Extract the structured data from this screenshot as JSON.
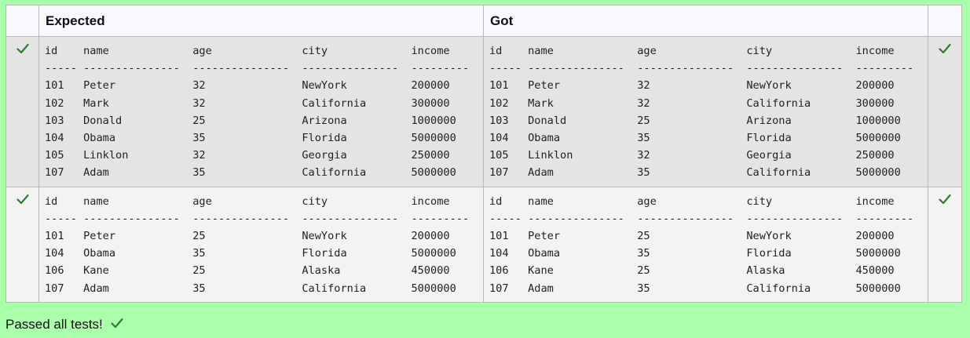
{
  "header": {
    "expected_label": "Expected",
    "got_label": "Got"
  },
  "tests": [
    {
      "expected": "id    name             age              city             income\n----- ---------------  ---------------  ---------------  ---------\n101   Peter            32               NewYork          200000\n102   Mark             32               California       300000\n103   Donald           25               Arizona          1000000\n104   Obama            35               Florida          5000000\n105   Linklon          32               Georgia          250000\n107   Adam             35               California       5000000",
      "got": "id    name             age              city             income\n----- ---------------  ---------------  ---------------  ---------\n101   Peter            32               NewYork          200000\n102   Mark             32               California       300000\n103   Donald           25               Arizona          1000000\n104   Obama            35               Florida          5000000\n105   Linklon          32               Georgia          250000\n107   Adam             35               California       5000000"
    },
    {
      "expected": "id    name             age              city             income\n----- ---------------  ---------------  ---------------  ---------\n101   Peter            25               NewYork          200000\n104   Obama            35               Florida          5000000\n106   Kane             25               Alaska           450000\n107   Adam             35               California       5000000",
      "got": "id    name             age              city             income\n----- ---------------  ---------------  ---------------  ---------\n101   Peter            25               NewYork          200000\n104   Obama            35               Florida          5000000\n106   Kane             25               Alaska           450000\n107   Adam             35               California       5000000"
    }
  ],
  "status_text": "Passed all tests!",
  "icons": {
    "pass": "check-icon"
  },
  "colors": {
    "page_bg": "#aaffaa",
    "check": "#2e7d32"
  }
}
